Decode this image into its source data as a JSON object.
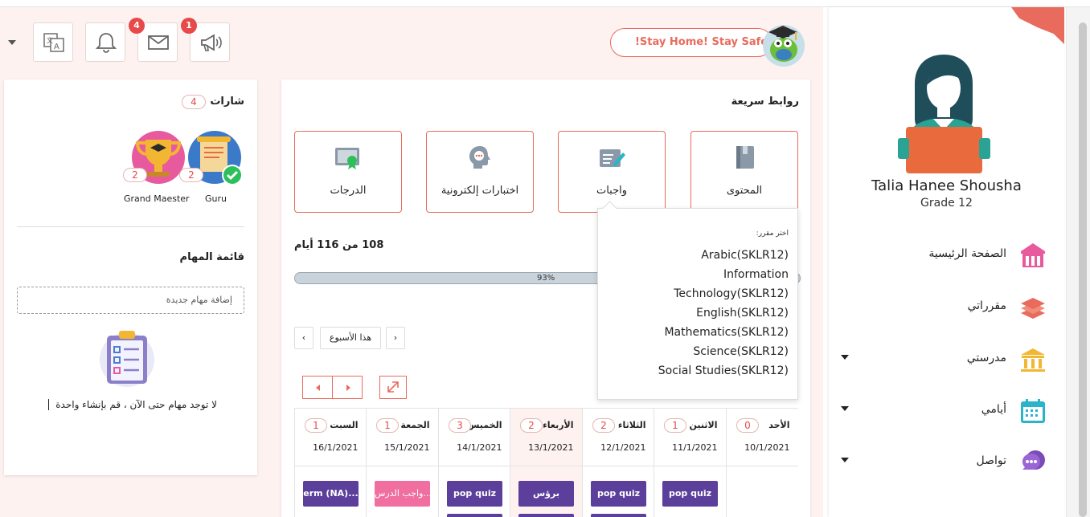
{
  "colors": {
    "accent": "#e96b5d",
    "badge": "#e64a4a",
    "event_purple": "#5b3f9b",
    "event_pink": "#f06fa0",
    "background": "#fdf2f0"
  },
  "header": {
    "stay_home": "!Stay Home! Stay Safe",
    "icons": [
      "language-icon",
      "bell-icon",
      "mail-icon",
      "megaphone-icon"
    ],
    "mail_badge": "4",
    "announce_badge": "1"
  },
  "profile": {
    "name": "Talia Hanee Shousha",
    "grade": "Grade 12"
  },
  "nav": {
    "items": [
      {
        "label": "الصفحة الرئيسية",
        "icon": "school-building-icon"
      },
      {
        "label": "مقرراتي",
        "icon": "books-stack-icon"
      },
      {
        "label": "مدرستي",
        "icon": "columns-building-icon"
      },
      {
        "label": "أيامي",
        "icon": "calendar-icon"
      },
      {
        "label": "تواصل",
        "icon": "chat-bubbles-icon"
      }
    ]
  },
  "badges": {
    "title": "شارات",
    "count": "4",
    "items": [
      {
        "name": "Guru",
        "count": "2",
        "icon": "scroll-badge-icon"
      },
      {
        "name": "Grand Maester",
        "count": "2",
        "icon": "trophy-badge-icon"
      }
    ]
  },
  "tasks": {
    "title": "قائمة المهام",
    "placeholder": "إضافة مهام جديدة",
    "empty": "لا توجد مهام حتى الآن ، قم بإنشاء واحدة"
  },
  "quick_links": {
    "title": "روابط سريعة",
    "items": [
      {
        "label": "المحتوى",
        "icon": "book-icon"
      },
      {
        "label": "واجبات",
        "icon": "homework-pen-icon"
      },
      {
        "label": "اختبارات إلكترونية",
        "icon": "quiz-head-icon"
      },
      {
        "label": "الدرجات",
        "icon": "certificate-icon"
      }
    ]
  },
  "progress": {
    "days": "108 من 116 أيام",
    "percent": "93%",
    "value": 0.93
  },
  "week": {
    "this_week": "هذا الأسبوع",
    "prev": "‹",
    "next": "›"
  },
  "calendar": {
    "days": [
      {
        "name": "الأحد",
        "count": "0",
        "date": "10/1/2021",
        "events": []
      },
      {
        "name": "الاثنين",
        "count": "1",
        "date": "11/1/2021",
        "events": [
          "pop quiz"
        ]
      },
      {
        "name": "الثلاثاء",
        "count": "2",
        "date": "12/1/2021",
        "events": [
          "pop quiz"
        ]
      },
      {
        "name": "الأربعاء",
        "count": "2",
        "date": "13/1/2021",
        "events": [
          "برؤس"
        ]
      },
      {
        "name": "الخميس",
        "count": "3",
        "date": "14/1/2021",
        "events": [
          "pop quiz"
        ]
      },
      {
        "name": "الجمعة",
        "count": "1",
        "date": "15/1/2021",
        "events": [
          "واجب الدرس..."
        ]
      },
      {
        "name": "السبت",
        "count": "1",
        "date": "16/1/2021",
        "events": [
          "erm (NA)..."
        ]
      }
    ]
  },
  "course_popup": {
    "heading": "اختر مقرر:",
    "options": [
      "Arabic(SKLR12)",
      "Information",
      "Technology(SKLR12)",
      "English(SKLR12)",
      "Mathematics(SKLR12)",
      "Science(SKLR12)",
      "Social Studies(SKLR12)"
    ]
  }
}
